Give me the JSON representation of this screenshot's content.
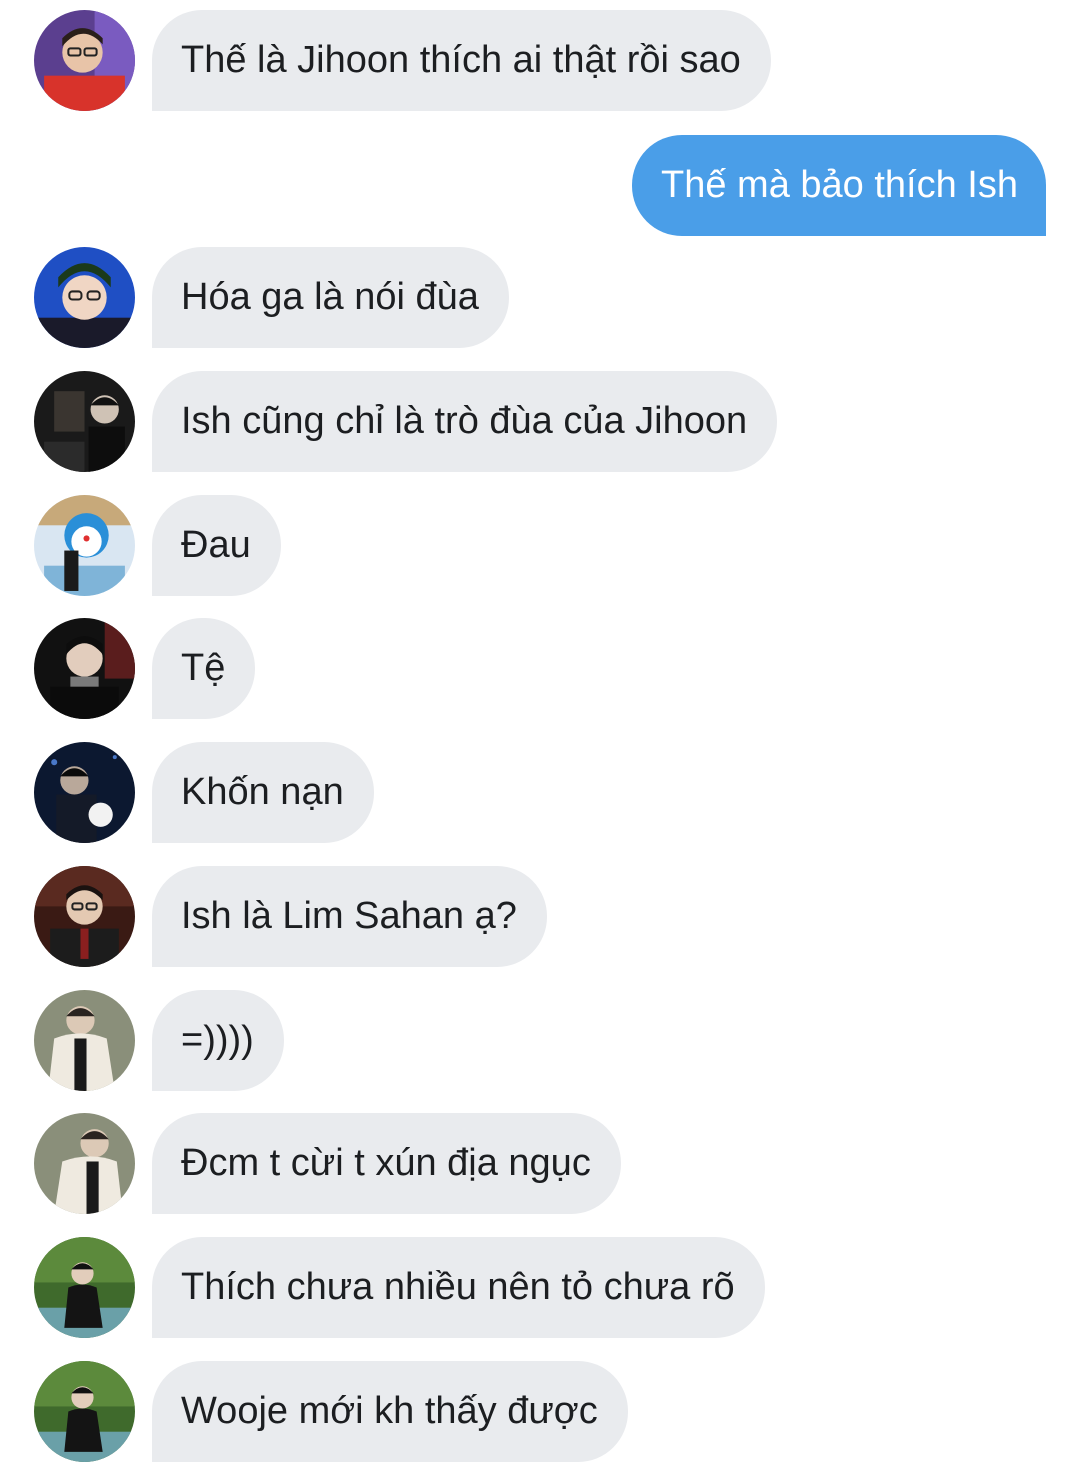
{
  "colors": {
    "incoming_bubble": "#e9ebee",
    "incoming_text": "#1c1e21",
    "outgoing_bubble": "#4a9ee8",
    "outgoing_text": "#ffffff"
  },
  "messages": [
    {
      "direction": "incoming",
      "text": "Thế là Jihoon thích ai thật rồi sao",
      "avatar": "avatar-photo"
    },
    {
      "direction": "outgoing",
      "text": "Thế mà bảo thích Ish"
    },
    {
      "direction": "incoming",
      "text": "Hóa ga là nói đùa",
      "avatar": "avatar-photo"
    },
    {
      "direction": "incoming",
      "text": "Ish cũng chỉ là trò đùa của Jihoon",
      "avatar": "avatar-photo"
    },
    {
      "direction": "incoming",
      "text": "Đau",
      "avatar": "avatar-photo"
    },
    {
      "direction": "incoming",
      "text": "Tệ",
      "avatar": "avatar-photo"
    },
    {
      "direction": "incoming",
      "text": "Khốn nạn",
      "avatar": "avatar-photo"
    },
    {
      "direction": "incoming",
      "text": "Ish là Lim Sahan ạ?",
      "avatar": "avatar-photo"
    },
    {
      "direction": "incoming",
      "text": "=))))",
      "avatar": "avatar-photo"
    },
    {
      "direction": "incoming",
      "text": "Đcm t cừi t xún địa ngục",
      "avatar": "avatar-photo"
    },
    {
      "direction": "incoming",
      "text": "Thích chưa nhiều nên tỏ chưa rõ",
      "avatar": "avatar-photo"
    },
    {
      "direction": "incoming",
      "text": "Wooje mới kh thấy được",
      "avatar": "avatar-photo"
    }
  ]
}
